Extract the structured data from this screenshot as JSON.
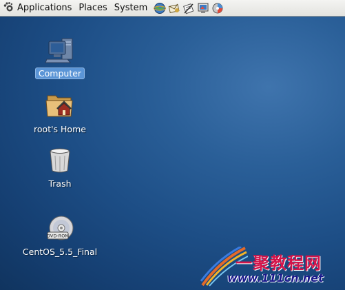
{
  "panel": {
    "menus": [
      {
        "label": "Applications"
      },
      {
        "label": "Places"
      },
      {
        "label": "System"
      }
    ],
    "launchers": [
      "web-browser-icon",
      "email-client-icon",
      "text-editor-icon",
      "display-settings-icon",
      "network-icon"
    ]
  },
  "desktop": {
    "icons": [
      {
        "label": "Computer",
        "icon": "computer-icon",
        "selected": true
      },
      {
        "label": "root's Home",
        "icon": "home-folder-icon",
        "selected": false
      },
      {
        "label": "Trash",
        "icon": "trash-icon",
        "selected": false
      },
      {
        "label": "CentOS_5.5_Final",
        "icon": "dvd-rom-icon",
        "selected": false,
        "disc_text": "DVD-ROM"
      }
    ]
  },
  "watermark": {
    "title": "一聚教程网",
    "url": "www.111cn.net"
  }
}
